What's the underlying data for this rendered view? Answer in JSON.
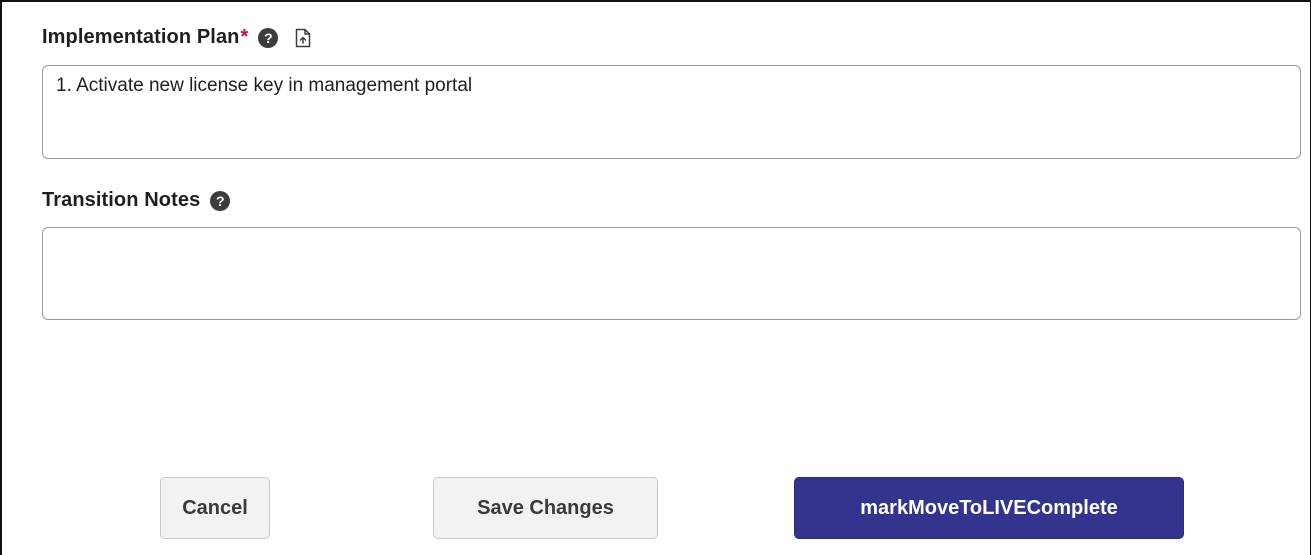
{
  "implementation_plan": {
    "label": "Implementation Plan",
    "required_marker": "*",
    "help_icon": "?",
    "icons": [
      "help-icon",
      "file-upload-icon"
    ],
    "value": "1. Activate new license key in management portal"
  },
  "transition_notes": {
    "label": "Transition Notes",
    "help_icon": "?",
    "icons": [
      "help-icon"
    ],
    "value": ""
  },
  "actions": {
    "cancel_label": "Cancel",
    "save_label": "Save Changes",
    "complete_label": "markMoveToLIVEComplete"
  },
  "colors": {
    "primary_button": "#33348e",
    "required_star": "#c8102e",
    "secondary_button": "#f2f2f2"
  }
}
